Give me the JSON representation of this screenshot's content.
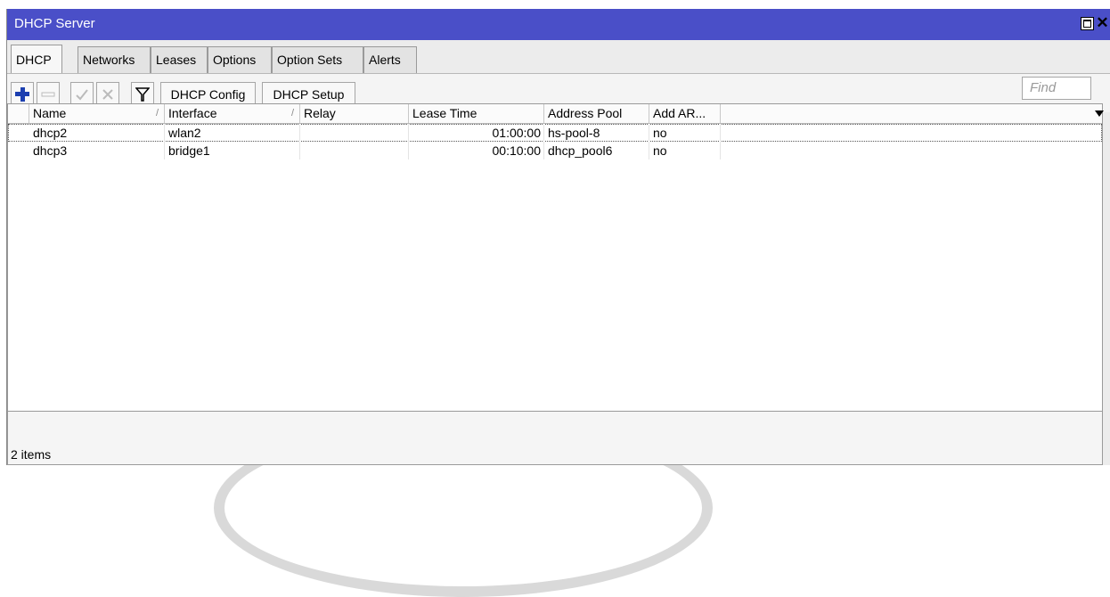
{
  "window": {
    "title": "DHCP Server"
  },
  "tabs": [
    {
      "label": "DHCP",
      "active": true
    },
    {
      "label": "Networks"
    },
    {
      "label": "Leases"
    },
    {
      "label": "Options"
    },
    {
      "label": "Option Sets"
    },
    {
      "label": "Alerts"
    }
  ],
  "toolbar": {
    "add_icon": "plus-icon",
    "remove_icon": "minus-icon",
    "enable_icon": "check-icon",
    "disable_icon": "cross-icon",
    "filter_icon": "filter-icon",
    "dhcp_config": "DHCP Config",
    "dhcp_setup": "DHCP Setup",
    "find_placeholder": "Find"
  },
  "table": {
    "columns": [
      "Name",
      "Interface",
      "Relay",
      "Lease Time",
      "Address Pool",
      "Add AR..."
    ],
    "rows": [
      {
        "name": "dhcp2",
        "interface": "wlan2",
        "relay": "",
        "lease_time": "01:00:00",
        "address_pool": "hs-pool-8",
        "add_arp": "no"
      },
      {
        "name": "dhcp3",
        "interface": "bridge1",
        "relay": "",
        "lease_time": "00:10:00",
        "address_pool": "dhcp_pool6",
        "add_arp": "no"
      }
    ]
  },
  "status": {
    "count": "2 items"
  },
  "colors": {
    "titlebar": "#4a4fc8",
    "add": "#1c3fb0"
  }
}
